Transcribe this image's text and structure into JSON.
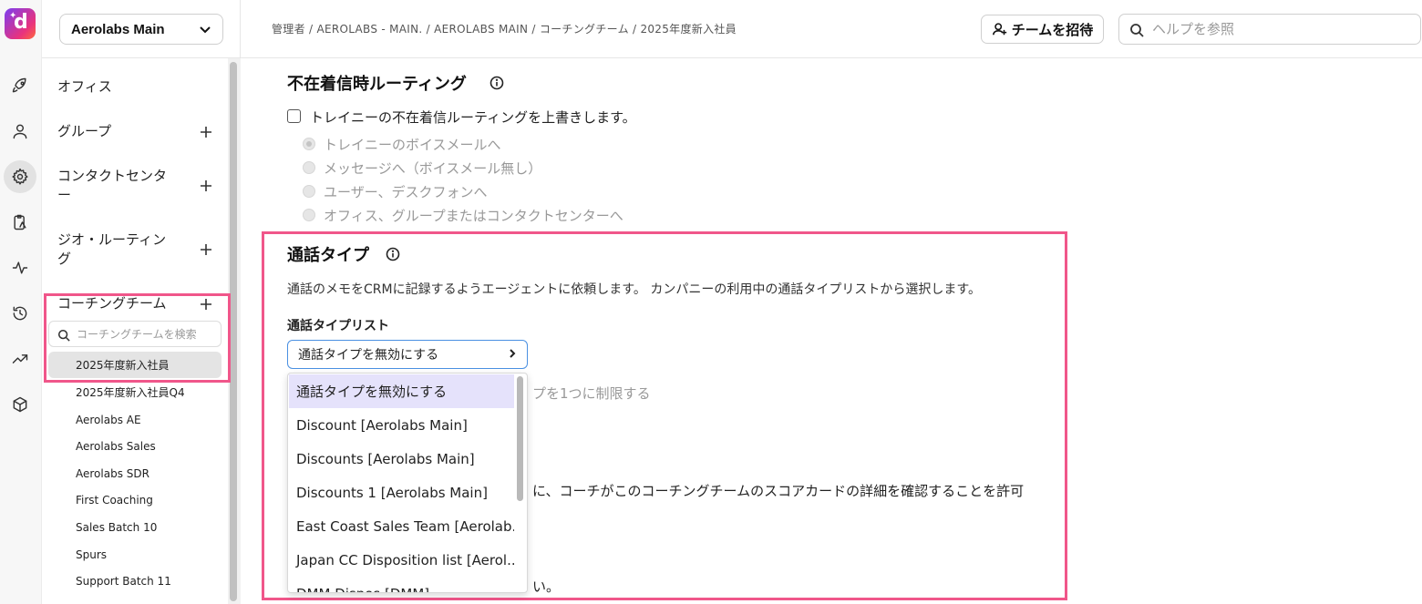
{
  "rail": {
    "logo_letter": "d",
    "icons": [
      "rocket-icon",
      "user-icon",
      "gear-icon",
      "clipboard-icon",
      "activity-icon",
      "history-icon",
      "trending-up-icon",
      "cube-icon"
    ]
  },
  "sidebar": {
    "workspace": "Aerolabs Main",
    "items": {
      "office": "オフィス",
      "groups": "グループ",
      "contact_center": "コンタクトセンター",
      "geo_routing": "ジオ・ルーティング",
      "coaching_teams": "コーチングチーム"
    },
    "coaching_search_placeholder": "コーチングチームを検索",
    "teams": [
      "2025年度新入社員",
      "2025年度新入社員Q4",
      "Aerolabs AE",
      "Aerolabs Sales",
      "Aerolabs SDR",
      "First Coaching",
      "Sales Batch 10",
      "Spurs",
      "Support Batch 11"
    ]
  },
  "header": {
    "breadcrumb": "管理者 / AEROLABS - MAIN. / AEROLABS MAIN / コーチングチーム / 2025年度新入社員",
    "invite_label": "チームを招待",
    "help_placeholder": "ヘルプを参照"
  },
  "missed_call": {
    "title": "不在着信時ルーティング",
    "override_label": "トレイニーの不在着信ルーティングを上書きします。",
    "options": [
      "トレイニーのボイスメールへ",
      "メッセージへ（ボイスメール無し）",
      "ユーザー、デスクフォンへ",
      "オフィス、グループまたはコンタクトセンターへ"
    ]
  },
  "call_type": {
    "title": "通話タイプ",
    "description": "通話のメモをCRMに記録するようエージェントに依頼します。 カンパニーの利用中の通話タイプリストから選択します。",
    "list_label": "通話タイプリスト",
    "selected": "通話タイプを無効にする",
    "options": [
      "通話タイプを無効にする",
      "Discount [Aerolabs Main]",
      "Discounts [Aerolabs Main]",
      "Discounts 1 [Aerolabs Main]",
      "East Coast Sales Team [Aerolab...",
      "Japan CC Disposition list [Aerol...",
      "DMM Dispos [DMM]"
    ],
    "behind_text_1": "プを1つに制限する",
    "behind_text_2": "に、コーチがこのコーチングチームのスコアカードの詳細を確認することを許可",
    "behind_text_3": "い。"
  }
}
